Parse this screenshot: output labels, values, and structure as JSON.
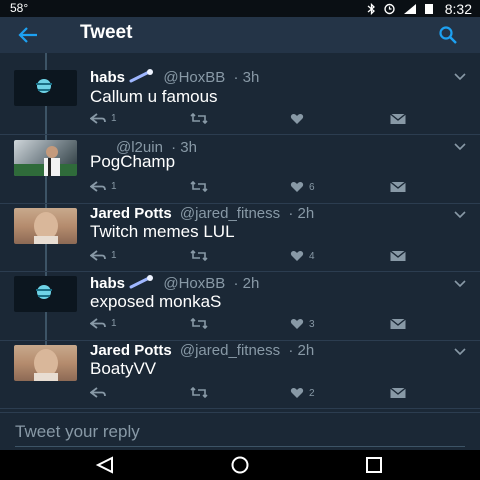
{
  "status_bar": {
    "temperature": "58°",
    "time": "8:32",
    "icons": [
      "bluetooth-icon",
      "alarm-icon",
      "signal-icon",
      "battery-icon"
    ]
  },
  "app_bar": {
    "title": "Tweet",
    "icons": [
      "back-arrow-icon",
      "search-icon"
    ]
  },
  "colors": {
    "background": "#1b2836",
    "app_bar": "#243447",
    "accent": "#1da1f2",
    "muted": "#8899a6"
  },
  "tweets": [
    {
      "name": "habs",
      "badge": "comet-emoji",
      "handle": "@HoxBB",
      "time": "3h",
      "text": "Callum u famous",
      "replies": "1",
      "retweets": "",
      "likes": ""
    },
    {
      "name": "",
      "handle": "@l2uin",
      "time": "3h",
      "text": "PogChamp",
      "replies": "1",
      "retweets": "",
      "likes": "6"
    },
    {
      "name": "Jared Potts",
      "handle": "@jared_fitness",
      "time": "2h",
      "text": "Twitch memes LUL",
      "replies": "1",
      "retweets": "",
      "likes": "4"
    },
    {
      "name": "habs",
      "badge": "comet-emoji",
      "handle": "@HoxBB",
      "time": "2h",
      "text": "exposed monkaS",
      "replies": "1",
      "retweets": "",
      "likes": "3"
    },
    {
      "name": "Jared Potts",
      "handle": "@jared_fitness",
      "time": "2h",
      "text": "BoatyVV",
      "replies": "",
      "retweets": "",
      "likes": "2"
    }
  ],
  "reply_box": {
    "placeholder": "Tweet your reply"
  },
  "nav_bar": {
    "icons": [
      "back-triangle-icon",
      "home-circle-icon",
      "recents-square-icon"
    ]
  }
}
